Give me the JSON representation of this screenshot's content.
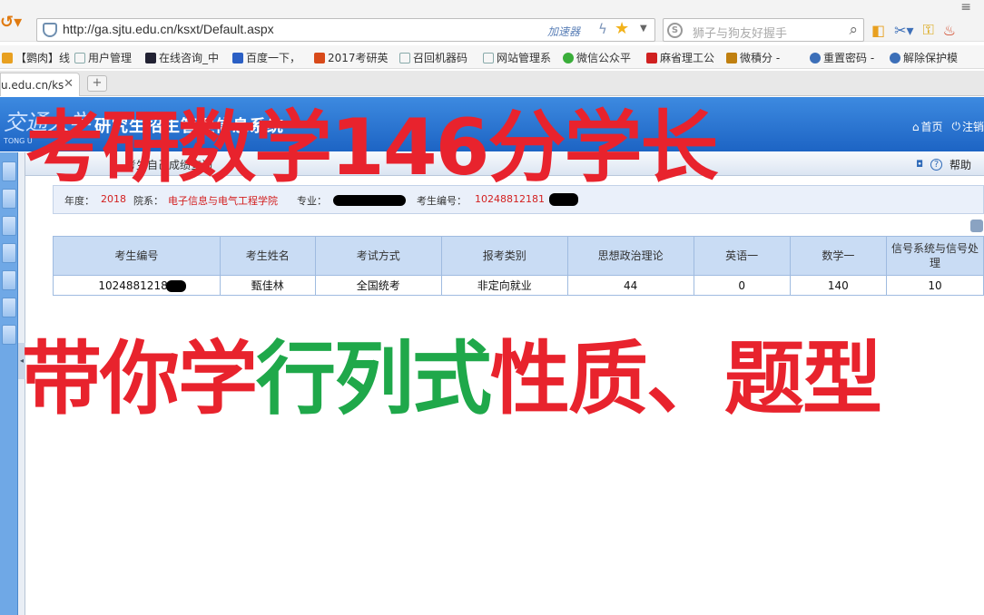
{
  "browser": {
    "url": "http://ga.sjtu.edu.cn/ksxt/Default.aspx",
    "accelerator": "加速器",
    "search_placeholder": "狮子与狗友好握手",
    "tab_title": "u.edu.cn/ks",
    "bookmarks": [
      "【鹦肉】线",
      "用户管理",
      "在线咨询_中",
      "百度一下，",
      "2017考研英",
      "召回机器码",
      "网站管理系",
      "微信公众平",
      "麻省理工公",
      "微積分 - ",
      "重置密码 -",
      "解除保护模"
    ]
  },
  "app": {
    "logo": "交通大学",
    "logo_sub": "TONG U",
    "title": "研究生招生管理信息系统",
    "home_link": "首页",
    "logout_link": "注销",
    "breadcrumb": "考生自己成绩查询",
    "help_link": "帮助"
  },
  "info": {
    "year_label": "年度：",
    "year": "2018",
    "dept_label": "院系：",
    "dept": "电子信息与电气工程学院",
    "major_label": "专业：",
    "examno_label": "考生编号：",
    "examno": "10248812181"
  },
  "table": {
    "headers": [
      "考生编号",
      "考生姓名",
      "考试方式",
      "报考类别",
      "思想政治理论",
      "英语一",
      "数学一",
      "信号系统与信号处理"
    ],
    "row": [
      "10248812181",
      "甄佳林",
      "全国统考",
      "非定向就业",
      "44",
      "0",
      "140",
      "10"
    ]
  },
  "overlay": {
    "line1": "考研数学146分学长",
    "line2_part1": "带你学",
    "line2_part2": "行列式",
    "line2_part3": "性质、题型"
  },
  "colors": {
    "overlay_red": "#e8232d",
    "overlay_green": "#1fa84a",
    "header_blue": "#1d64c4",
    "value_red": "#d32020"
  }
}
